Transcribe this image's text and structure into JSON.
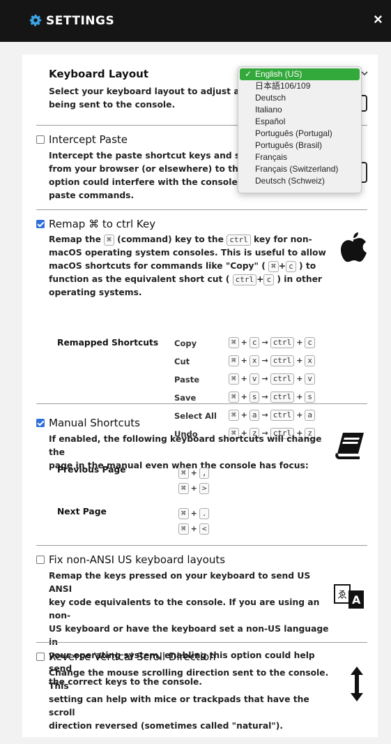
{
  "window": {
    "title": "SETTINGS",
    "close_glyph": "×"
  },
  "keyboard_layout": {
    "title": "Keyboard Layout",
    "desc_lines": [
      "Select your keyboard layout to adjust any",
      "being sent to the console."
    ],
    "options": [
      "English (US)",
      "日本語106/109",
      "Deutsch",
      "Italiano",
      "Español",
      "Português (Portugal)",
      "Português (Brasil)",
      "Français",
      "Français (Switzerland)",
      "Deutsch (Schweiz)"
    ],
    "selected_mark": "✓"
  },
  "intercept_paste": {
    "checked": false,
    "title": "Intercept Paste",
    "desc_lines": [
      "Intercept the paste shortcut keys and sen",
      "from your browser (or elsewhere) to the c",
      "option could interfere with the console's c",
      "paste commands."
    ]
  },
  "remap": {
    "checked": true,
    "title": "Remap ⌘ to ctrl Key",
    "desc": {
      "l1a": "Remap the ",
      "cmd": "⌘",
      "l1b": " (command) key to the ",
      "ctrl": "ctrl",
      "l1c": " key for non-",
      "l2": "macOS operating system consoles. This is useful to allow",
      "l3a": "macOS shortcuts for commands like \"Copy\" ( ",
      "plus": "+",
      "c": "c",
      "l3b": " ) to",
      "l4a": "function as the equivalent short cut ( ",
      "l4b": " ) in other",
      "l5": "operating systems."
    },
    "shortcuts_label": "Remapped Shortcuts",
    "arrow": "→",
    "shortcuts": [
      {
        "name": "Copy",
        "key": "c"
      },
      {
        "name": "Cut",
        "key": "x"
      },
      {
        "name": "Paste",
        "key": "v"
      },
      {
        "name": "Save",
        "key": "s"
      },
      {
        "name": "Select All",
        "key": "a"
      },
      {
        "name": "Undo",
        "key": "z"
      }
    ]
  },
  "manual": {
    "checked": true,
    "title": "Manual Shortcuts",
    "desc_lines": [
      "If enabled, the following keyboard shortcuts will change the",
      "page in the manual even when the console has focus:"
    ],
    "prev_label": "Previous Page",
    "next_label": "Next Page",
    "prev_keys": [
      ",",
      ">"
    ],
    "next_keys": [
      ".",
      "<"
    ]
  },
  "fix_ansi": {
    "checked": false,
    "title": "Fix non-ANSI US keyboard layouts",
    "desc_lines": [
      "Remap the keys pressed on your keyboard to send US ANSI",
      "key code equivalents to the console. If you are using an non-",
      "US keyboard or have the keyboard set a non-US language in",
      "your operating system, enabling this option could help send",
      "the correct keys to the console."
    ]
  },
  "reverse_scroll": {
    "checked": false,
    "title": "Reverse Vertical Scroll Direction",
    "desc_lines": [
      "Change the mouse scrolling direction sent to the console. This",
      "setting can help with mice or trackpads that have the scroll",
      "direction reversed (sometimes called \"natural\")."
    ]
  },
  "icons": {
    "settings": "gear-icon",
    "close": "close-icon",
    "apple": "apple-icon",
    "manual": "book-icon",
    "translate": "translate-icon",
    "scroll": "vertical-arrows-icon"
  }
}
